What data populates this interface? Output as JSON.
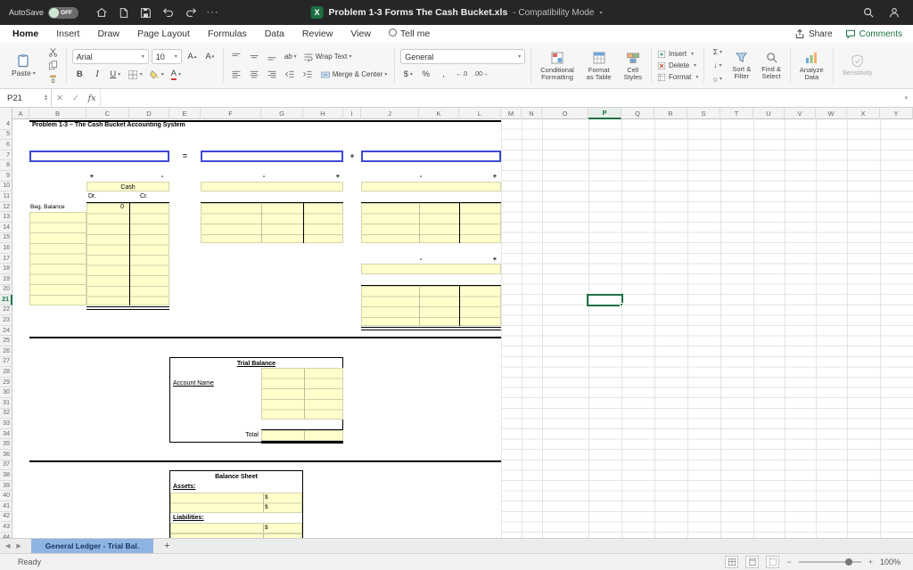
{
  "colors": {
    "selection_green": "#1e7145",
    "input_yellow": "#ffffcc",
    "equation_blue": "#3d49d6",
    "active_tab_blue": "#8eb4e3",
    "excel_green": "#1d6f42"
  },
  "titlebar": {
    "autosave_label": "AutoSave",
    "autosave_state": "OFF",
    "app_icon_letter": "X",
    "doc_title": "Problem 1-3 Forms The Cash Bucket.xls",
    "mode_suffix": "- Compatibility Mode"
  },
  "menubar": {
    "items": [
      "Home",
      "Insert",
      "Draw",
      "Page Layout",
      "Formulas",
      "Data",
      "Review",
      "View",
      "Tell me"
    ],
    "share": "Share",
    "comments": "Comments"
  },
  "ribbon": {
    "paste": "Paste",
    "font": "Arial",
    "font_size": "10",
    "bold": "B",
    "italic": "I",
    "underline": "U",
    "wrap": "Wrap Text",
    "merge": "Merge & Center",
    "number_format": "General",
    "dollar": "$",
    "percent": "%",
    "comma": ",",
    "dec1": "←.0",
    "dec2": ".00→",
    "conditional": [
      "Conditional",
      "Formatting"
    ],
    "format_table": [
      "Format",
      "as Table"
    ],
    "cell_styles": [
      "Cell",
      "Styles"
    ],
    "insert": "Insert",
    "delete": "Delete",
    "format": "Format",
    "autosum": "Σ",
    "sort": [
      "Sort &",
      "Filter"
    ],
    "find": [
      "Find &",
      "Select"
    ],
    "analyze": [
      "Analyze",
      "Data"
    ],
    "sensitivity": "Sensitivity"
  },
  "formula_bar": {
    "name_box": "P21",
    "cancel": "✕",
    "enter": "✓",
    "fx": "fx"
  },
  "grid": {
    "columns": [
      "A",
      "B",
      "C",
      "D",
      "E",
      "F",
      "G",
      "H",
      "I",
      "J",
      "K",
      "L",
      "M",
      "N",
      "O",
      "P",
      "Q",
      "R",
      "S",
      "T",
      "U",
      "V",
      "W",
      "X",
      "Y"
    ],
    "row_first": 4,
    "row_last": 44,
    "selected_column": "P",
    "selected_row": 21,
    "selected_cell": "P21"
  },
  "sheet_content": {
    "title": "Problem 1-3 – The Cash Bucket Accounting System",
    "equation": {
      "equals": "=",
      "plus": "+"
    },
    "signs": {
      "plus": "+",
      "minus": "-"
    },
    "cash_account": {
      "name": "Cash",
      "dr": "Dr.",
      "cr": "Cr.",
      "beg_balance_label": "Beg. Balance",
      "beg_balance_value": "0"
    },
    "trial_balance": {
      "title": "Trial Balance",
      "account_name_label": "Account Name",
      "total_label": "Total"
    },
    "balance_sheet": {
      "title": "Balance Sheet",
      "assets_label": "Assets:",
      "liabilities_label": "Liabilities:",
      "currency": "$"
    }
  },
  "sheet_tabs": {
    "active": "General Ledger - Trial Bal.",
    "add": "+"
  },
  "statusbar": {
    "status": "Ready",
    "zoom": "100%"
  }
}
